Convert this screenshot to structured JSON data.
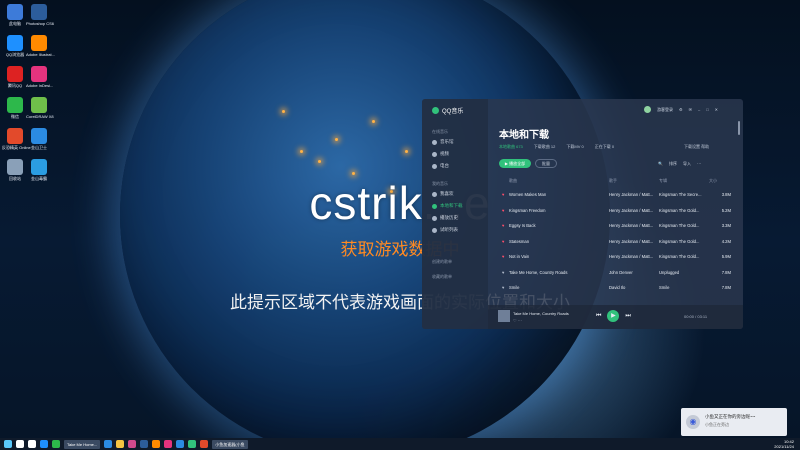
{
  "desktop": {
    "icons": [
      {
        "label": "此电脑",
        "icon": "computer-icon",
        "color": "#3d7bd9"
      },
      {
        "label": "Photoshop CS6",
        "icon": "photoshop-icon",
        "color": "#2c5d9b"
      },
      {
        "label": "QQ浏览器",
        "icon": "qq-browser-icon",
        "color": "#1e90ff"
      },
      {
        "label": "Adobe Illustrat...",
        "icon": "illustrator-icon",
        "color": "#ff8a00"
      },
      {
        "label": "腾讯QQ",
        "icon": "qq-icon",
        "color": "#d22"
      },
      {
        "label": "Adobe InDesi...",
        "icon": "indesign-icon",
        "color": "#e5337e"
      },
      {
        "label": "微信",
        "icon": "wechat-icon",
        "color": "#2db84b"
      },
      {
        "label": "CorelDRAW X8",
        "icon": "coreldraw-icon",
        "color": "#6fbf4a"
      },
      {
        "label": "反恐精英 Online",
        "icon": "cs-online-icon",
        "color": "#e24a2b"
      },
      {
        "label": "金山卫士",
        "icon": "shield-icon",
        "color": "#2b8be2"
      },
      {
        "label": "回收站",
        "icon": "recycle-bin-icon",
        "color": "#8aa0b8"
      },
      {
        "label": "金山毒霸",
        "icon": "antivirus-icon",
        "color": "#2b9de2"
      }
    ]
  },
  "overlay": {
    "title": "cstrik...e",
    "status": "获取游戏数据中",
    "hint": "此提示区域不代表游戏画面的实际位置和大小"
  },
  "player": {
    "app_name": "QQ音乐",
    "user": "游客登录",
    "sidebar": {
      "section1": "在线音乐",
      "items": [
        "音乐馆",
        "视频",
        "电台"
      ],
      "section2": "我的音乐",
      "my_items": [
        "我喜欢",
        "本地和下载",
        "播放历史",
        "试听列表"
      ],
      "section3": "创建的歌单",
      "section4": "收藏的歌单"
    },
    "title": "本地和下载",
    "tabs": [
      "本地歌曲 673",
      "下载歌曲 12",
      "下载MV 0",
      "正在下载 0"
    ],
    "tab_right": "下载设置  帮助",
    "play_all": "▶ 播放全部",
    "batch": "批量",
    "tools": [
      "🔍",
      "排序",
      "导入",
      "⋯"
    ],
    "columns": {
      "title": "歌曲",
      "singer": "歌手",
      "album": "专辑",
      "size": "大小"
    },
    "rows": [
      {
        "title": "Women Makes Man",
        "singer": "Henry Jackman / Matt...",
        "album": "Kingsman The Secre...",
        "size": "3.8M",
        "liked": true
      },
      {
        "title": "Kingsman Freedom",
        "singer": "Henry Jackman / Matt...",
        "album": "Kingsman The Gold...",
        "size": "5.2M",
        "liked": true
      },
      {
        "title": "Eggsy Is Back",
        "singer": "Henry Jackman / Matt...",
        "album": "Kingsman The Gold...",
        "size": "3.3M",
        "liked": true
      },
      {
        "title": "Statesman",
        "singer": "Henry Jackman / Matt...",
        "album": "Kingsman The Gold...",
        "size": "4.2M",
        "liked": true
      },
      {
        "title": "Not in Vain",
        "singer": "Henry Jackman / Matt...",
        "album": "Kingsman The Gold...",
        "size": "5.9M",
        "liked": true
      },
      {
        "title": "Take Me Home, Country Roads",
        "singer": "John Denver",
        "album": "Unplugged",
        "size": "7.8M",
        "liked": false
      },
      {
        "title": "Smile",
        "singer": "David Ilo",
        "album": "Smile",
        "size": "7.8M",
        "liked": false
      }
    ],
    "now_playing": {
      "title": "Take Me Home, Country Roads",
      "sub": "♡  ⋯",
      "time": "00:00 / 03:11"
    }
  },
  "toast": {
    "line1": "小鱼又正在你的旁边呢~~",
    "line2": "小鱼正在旁边"
  },
  "taskbar": {
    "apps": [
      {
        "icon": "windows-start-icon",
        "color": "#5ac8fa"
      },
      {
        "icon": "search-icon",
        "color": "#ffffff"
      },
      {
        "icon": "task-view-icon",
        "color": "#ffffff"
      },
      {
        "icon": "qq-browser-icon",
        "color": "#1e90ff"
      },
      {
        "icon": "wechat-icon",
        "color": "#2db84b"
      }
    ],
    "active_app": "Take Me Home...",
    "apps2": [
      {
        "icon": "edge-icon",
        "color": "#2b8be2"
      },
      {
        "icon": "explorer-icon",
        "color": "#f5c342"
      },
      {
        "icon": "app-icon",
        "color": "#d24a8c"
      },
      {
        "icon": "photoshop-icon",
        "color": "#2c5d9b"
      },
      {
        "icon": "illustrator-icon",
        "color": "#ff8a00"
      },
      {
        "icon": "indesign-icon",
        "color": "#e5337e"
      },
      {
        "icon": "shield-icon",
        "color": "#2b8be2"
      },
      {
        "icon": "qq-music-icon",
        "color": "#31c27c"
      },
      {
        "icon": "cs-online-icon",
        "color": "#e24a2b"
      }
    ],
    "active_app2": "小鱼加速器(小鱼",
    "clock_time": "10:42",
    "clock_date": "2021/11/24"
  }
}
